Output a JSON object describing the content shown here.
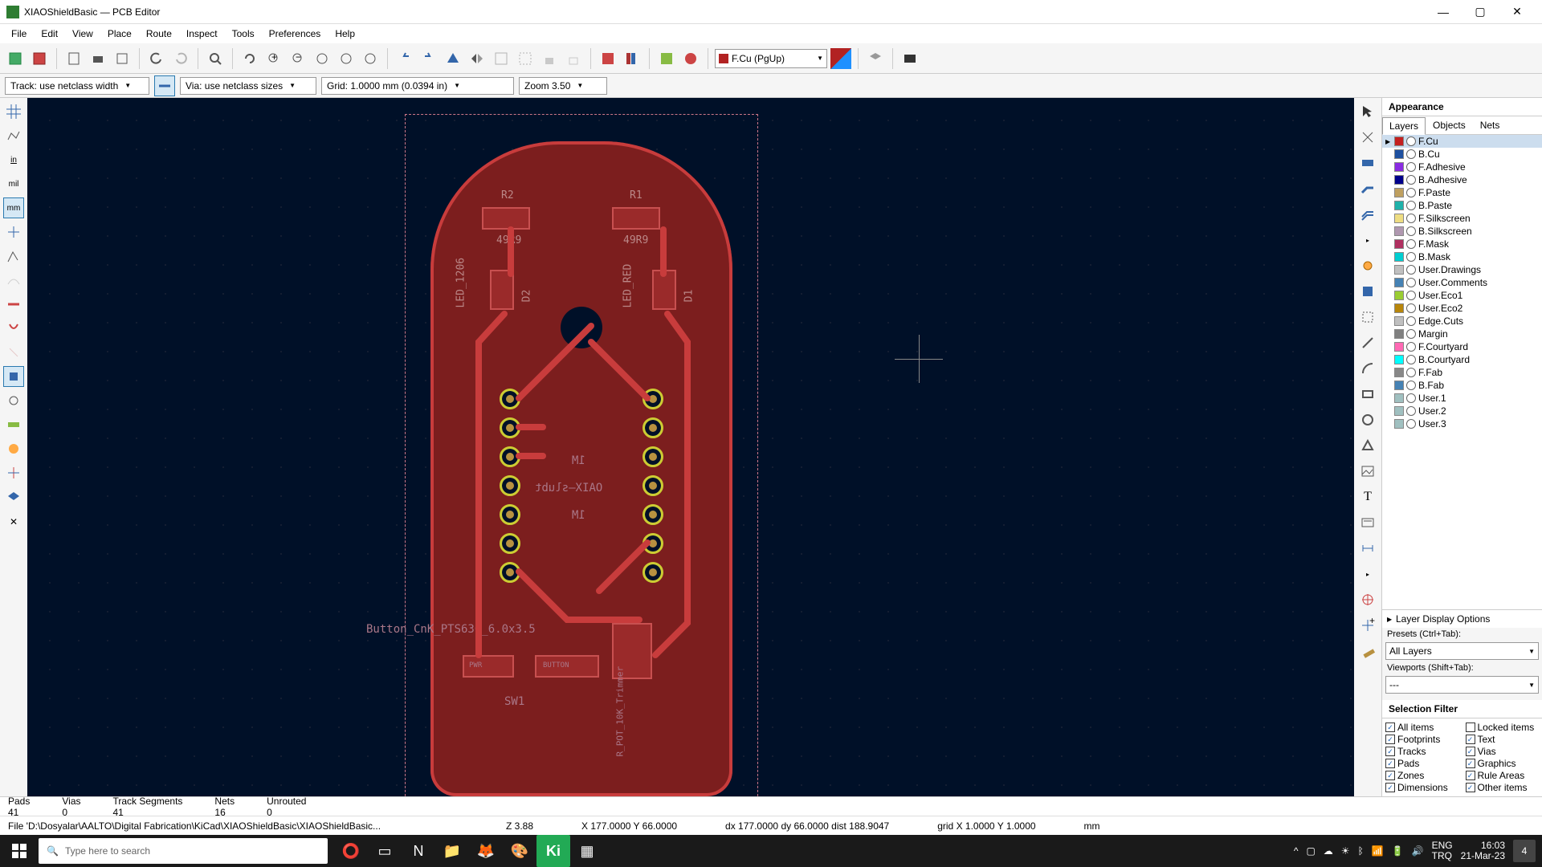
{
  "window": {
    "title": "XIAOShieldBasic — PCB Editor",
    "minimize": "—",
    "maximize": "▢",
    "close": "✕"
  },
  "menu": {
    "file": "File",
    "edit": "Edit",
    "view": "View",
    "place": "Place",
    "route": "Route",
    "inspect": "Inspect",
    "tools": "Tools",
    "preferences": "Preferences",
    "help": "Help"
  },
  "toolbar": {
    "layer_select": "F.Cu (PgUp)",
    "layer_color": "#b22222"
  },
  "toolbar2": {
    "track": "Track: use netclass width",
    "via": "Via: use netclass sizes",
    "grid": "Grid: 1.0000 mm (0.0394 in)",
    "zoom": "Zoom 3.50"
  },
  "appearance": {
    "title": "Appearance",
    "tabs": {
      "layers": "Layers",
      "objects": "Objects",
      "nets": "Nets"
    },
    "layers": [
      {
        "name": "F.Cu",
        "color": "#c42020",
        "sel": true
      },
      {
        "name": "B.Cu",
        "color": "#1e50a0"
      },
      {
        "name": "F.Adhesive",
        "color": "#8a2be2"
      },
      {
        "name": "B.Adhesive",
        "color": "#00008b"
      },
      {
        "name": "F.Paste",
        "color": "#bfa060"
      },
      {
        "name": "B.Paste",
        "color": "#20b2aa"
      },
      {
        "name": "F.Silkscreen",
        "color": "#eedd82"
      },
      {
        "name": "B.Silkscreen",
        "color": "#b098b0"
      },
      {
        "name": "F.Mask",
        "color": "#b03060"
      },
      {
        "name": "B.Mask",
        "color": "#00ced1"
      },
      {
        "name": "User.Drawings",
        "color": "#c0c0c0"
      },
      {
        "name": "User.Comments",
        "color": "#4682b4"
      },
      {
        "name": "User.Eco1",
        "color": "#9acd32"
      },
      {
        "name": "User.Eco2",
        "color": "#b8860b"
      },
      {
        "name": "Edge.Cuts",
        "color": "#c0c0c0"
      },
      {
        "name": "Margin",
        "color": "#808080"
      },
      {
        "name": "F.Courtyard",
        "color": "#ff69b4"
      },
      {
        "name": "B.Courtyard",
        "color": "#00ffff"
      },
      {
        "name": "F.Fab",
        "color": "#888888"
      },
      {
        "name": "B.Fab",
        "color": "#4682b4"
      },
      {
        "name": "User.1",
        "color": "#a0c0c0"
      },
      {
        "name": "User.2",
        "color": "#a0c0c0"
      },
      {
        "name": "User.3",
        "color": "#a0c0c0"
      }
    ],
    "layer_display_options": "Layer Display Options",
    "presets_label": "Presets (Ctrl+Tab):",
    "presets_value": "All Layers",
    "viewports_label": "Viewports (Shift+Tab):",
    "viewports_value": "---"
  },
  "selection_filter": {
    "title": "Selection Filter",
    "items": {
      "all": "All items",
      "locked": "Locked items",
      "footprints": "Footprints",
      "text": "Text",
      "tracks": "Tracks",
      "vias": "Vias",
      "pads": "Pads",
      "graphics": "Graphics",
      "zones": "Zones",
      "rule_areas": "Rule Areas",
      "dimensions": "Dimensions",
      "other": "Other items"
    }
  },
  "pcb": {
    "r2": "R2",
    "r1": "R1",
    "v1": "49R9",
    "v2": "49R9",
    "d2": "D2",
    "d1": "D1",
    "led_a": "LED_1206",
    "led_b": "LED_RED",
    "m1a": "1M",
    "xiao": "OAIX—slubt",
    "m1b": "1M",
    "button": "Button_CnK_PTS636_6.0x3.5",
    "pwr": "PWR",
    "btn": "BUTTON",
    "sw1": "SW1",
    "pot": "R_POT_10K_Trimmer"
  },
  "left_tools": {
    "grid": "grid-icon",
    "ratsnest": "ratsnest-icon",
    "in": "in",
    "mil": "mil",
    "mm": "mm"
  },
  "status1": {
    "pads_l": "Pads",
    "pads_v": "41",
    "vias_l": "Vias",
    "vias_v": "0",
    "tracks_l": "Track Segments",
    "tracks_v": "41",
    "nets_l": "Nets",
    "nets_v": "16",
    "unrouted_l": "Unrouted",
    "unrouted_v": "0"
  },
  "status2": {
    "file": "File 'D:\\Dosyalar\\AALTO\\Digital Fabrication\\KiCad\\XIAOShieldBasic\\XIAOShieldBasic...",
    "z": "Z 3.88",
    "xy": "X 177.0000  Y 66.0000",
    "dxy": "dx 177.0000  dy 66.0000  dist 188.9047",
    "grid": "grid X 1.0000  Y 1.0000",
    "unit": "mm"
  },
  "taskbar": {
    "search_placeholder": "Type here to search",
    "lang1": "ENG",
    "lang2": "TRQ",
    "time": "16:03",
    "date": "21-Mar-23",
    "notif": "4"
  }
}
